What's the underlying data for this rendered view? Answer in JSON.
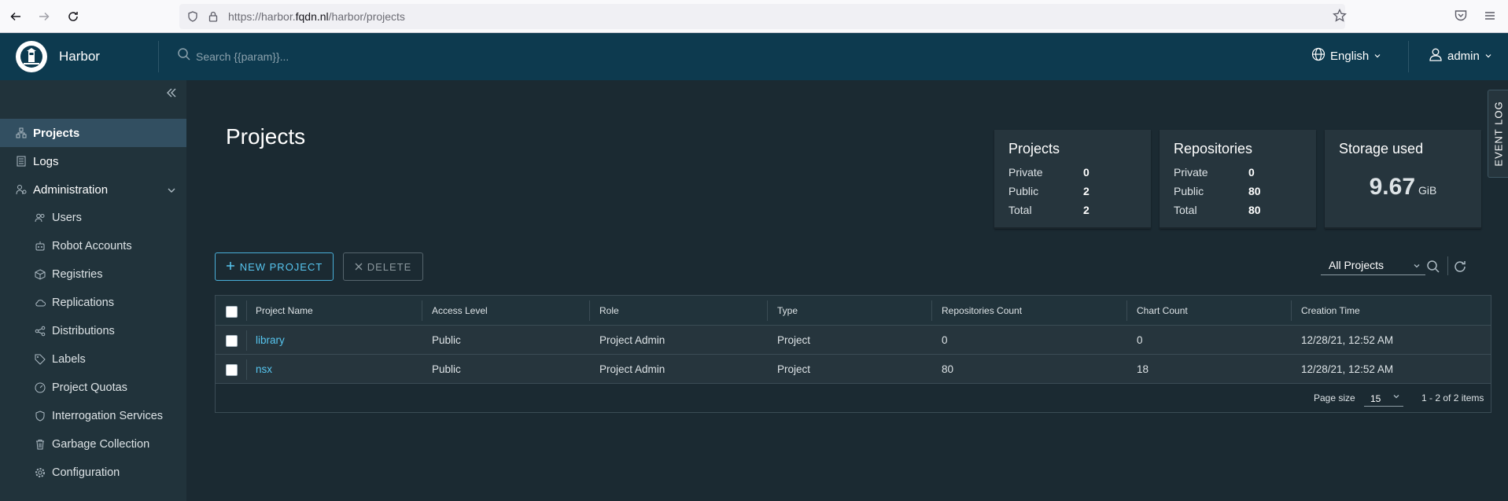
{
  "browser": {
    "url_prefix": "https://harbor.",
    "url_domain": "fqdn.nl",
    "url_path": "/harbor/projects"
  },
  "header": {
    "brand": "Harbor",
    "search_placeholder": "Search {{param}}...",
    "language": "English",
    "user": "admin"
  },
  "sidebar": {
    "items": [
      {
        "label": "Projects"
      },
      {
        "label": "Logs"
      },
      {
        "label": "Administration"
      }
    ],
    "admin_items": [
      {
        "label": "Users"
      },
      {
        "label": "Robot Accounts"
      },
      {
        "label": "Registries"
      },
      {
        "label": "Replications"
      },
      {
        "label": "Distributions"
      },
      {
        "label": "Labels"
      },
      {
        "label": "Project Quotas"
      },
      {
        "label": "Interrogation Services"
      },
      {
        "label": "Garbage Collection"
      },
      {
        "label": "Configuration"
      }
    ]
  },
  "main": {
    "title": "Projects",
    "event_log": "EVENT LOG",
    "cards": {
      "projects": {
        "title": "Projects",
        "private_label": "Private",
        "private": "0",
        "public_label": "Public",
        "public": "2",
        "total_label": "Total",
        "total": "2"
      },
      "repositories": {
        "title": "Repositories",
        "private_label": "Private",
        "private": "0",
        "public_label": "Public",
        "public": "80",
        "total_label": "Total",
        "total": "80"
      },
      "storage": {
        "title": "Storage used",
        "value": "9.67",
        "unit": "GiB"
      }
    },
    "toolbar": {
      "new_project": "NEW PROJECT",
      "delete": "DELETE",
      "filter": "All Projects"
    },
    "table": {
      "columns": [
        "Project Name",
        "Access Level",
        "Role",
        "Type",
        "Repositories Count",
        "Chart Count",
        "Creation Time"
      ],
      "rows": [
        {
          "name": "library",
          "access": "Public",
          "role": "Project Admin",
          "type": "Project",
          "repos": "0",
          "charts": "0",
          "created": "12/28/21, 12:52 AM"
        },
        {
          "name": "nsx",
          "access": "Public",
          "role": "Project Admin",
          "type": "Project",
          "repos": "80",
          "charts": "18",
          "created": "12/28/21, 12:52 AM"
        }
      ],
      "page_size_label": "Page size",
      "page_size": "15",
      "pagination": "1 - 2 of 2 items"
    }
  },
  "colors": {
    "header_bg": "#0d3a4f",
    "sidebar_bg": "#21333b",
    "main_bg": "#1b2a32",
    "accent": "#57c6f0"
  }
}
